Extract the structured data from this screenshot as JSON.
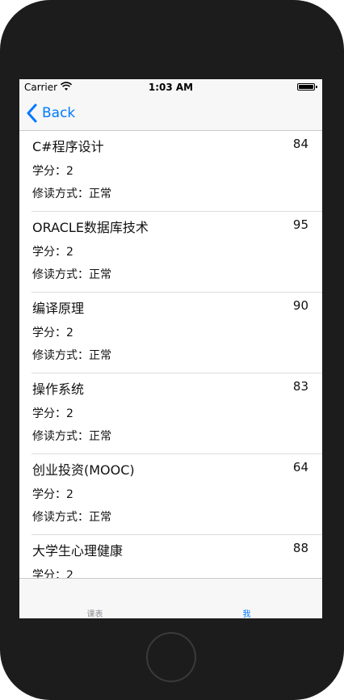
{
  "status_bar": {
    "carrier": "Carrier",
    "time": "1:03 AM"
  },
  "nav": {
    "back_label": "Back",
    "accent_color": "#007aff"
  },
  "courses": [
    {
      "name": "C#程序设计",
      "score": "84",
      "credit": "学分：2",
      "mode": "修读方式：正常"
    },
    {
      "name": "ORACLE数据库技术",
      "score": "95",
      "credit": "学分：2",
      "mode": "修读方式：正常"
    },
    {
      "name": "编译原理",
      "score": "90",
      "credit": "学分：2",
      "mode": "修读方式：正常"
    },
    {
      "name": "操作系统",
      "score": "83",
      "credit": "学分：2",
      "mode": "修读方式：正常"
    },
    {
      "name": "创业投资(MOOC)",
      "score": "64",
      "credit": "学分：2",
      "mode": "修读方式：正常"
    },
    {
      "name": "大学生心理健康",
      "score": "88",
      "credit": "学分：2",
      "mode": ""
    }
  ],
  "tabs": [
    {
      "label": "课表",
      "selected": false
    },
    {
      "label": "我",
      "selected": true
    }
  ]
}
